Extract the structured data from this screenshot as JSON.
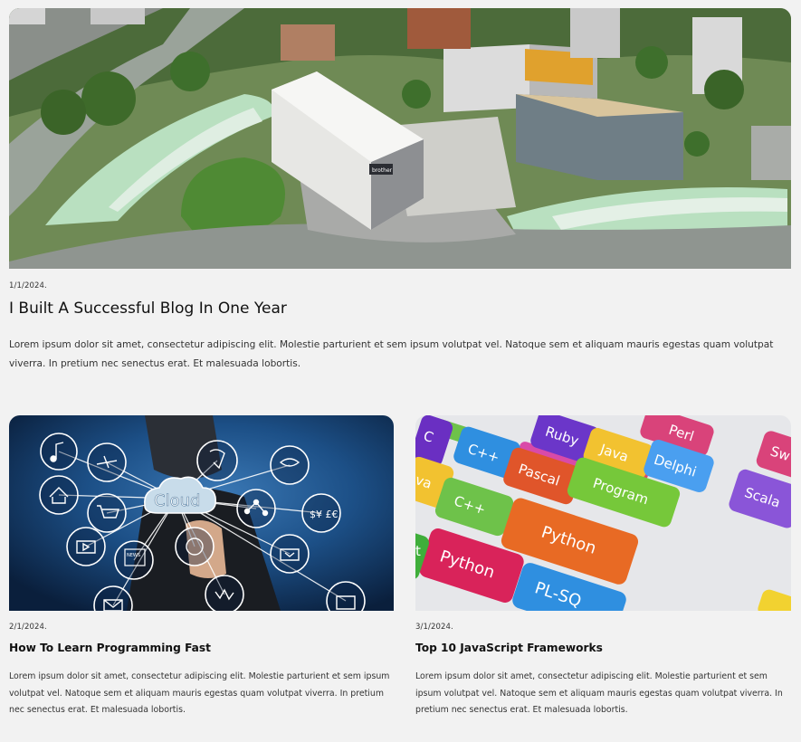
{
  "featured_post": {
    "date": "1/1/2024.",
    "title": "I Built A Successful Blog In One Year",
    "excerpt": "Lorem ipsum dolor sit amet, consectetur adipiscing elit. Molestie parturient et sem ipsum volutpat vel. Natoque sem et aliquam mauris egestas quam volutpat viverra. In pretium nec senectus erat. Et malesuada lobortis.",
    "image": {
      "subject": "aerial-office-campus-photo",
      "building_sign": "brother"
    }
  },
  "posts": [
    {
      "date": "2/1/2024.",
      "title": "How To Learn Programming Fast",
      "excerpt": "Lorem ipsum dolor sit amet, consectetur adipiscing elit. Molestie parturient et sem ipsum volutpat vel. Natoque sem et aliquam mauris egestas quam volutpat viverra. In pretium nec senectus erat. Et malesuada lobortis.",
      "image": {
        "subject": "cloud-network-icons-photo",
        "cloud_label": "Cloud",
        "news_label": "NEWS",
        "currency_label": "$¥ £€"
      }
    },
    {
      "date": "3/1/2024.",
      "title": "Top 10 JavaScript Frameworks",
      "excerpt": "Lorem ipsum dolor sit amet, consectetur adipiscing elit. Molestie parturient et sem ipsum volutpat vel. Natoque sem et aliquam mauris egestas quam volutpat viverra. In pretium nec senectus erat. Et malesuada lobortis.",
      "image": {
        "subject": "programming-language-keyboard-photo",
        "keys": [
          "C",
          "C++",
          "Ruby",
          "Java",
          "Perl",
          "Pascal",
          "Delphi",
          "Sw",
          "va",
          "C++",
          "Program",
          "Scala",
          "Python",
          "Python",
          "PL-SQ",
          "t"
        ]
      }
    }
  ]
}
